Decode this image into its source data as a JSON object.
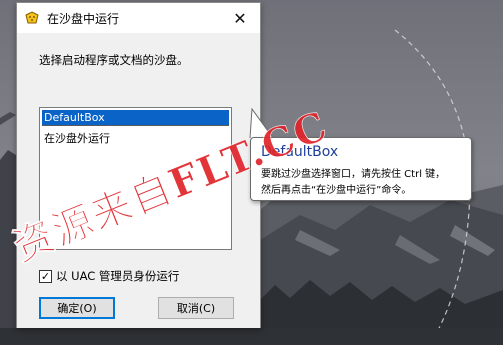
{
  "dialog": {
    "title": "在沙盘中运行",
    "close_label": "✕",
    "prompt": "选择启动程序或文档的沙盘。",
    "sandboxes": [
      {
        "label": "DefaultBox",
        "selected": true
      },
      {
        "label": "在沙盘外运行",
        "selected": false
      }
    ],
    "uac_checkbox": {
      "label": "以 UAC 管理员身份运行",
      "checked": true,
      "mark": "✓"
    },
    "ok_label": "确定(O)",
    "cancel_label": "取消(C)"
  },
  "tooltip": {
    "title": "DefaultBox",
    "line1": "要跳过沙盘选择窗口，请先按住 Ctrl 键，",
    "line2": "然后再点击“在沙盘中运行”命令。"
  },
  "watermark": {
    "text": "资源来自FLT.CC",
    "color": "#e0242a"
  },
  "colors": {
    "selection": "#0a64c8",
    "tooltip_title": "#1e3f9e",
    "default_button_border": "#0078d7"
  }
}
